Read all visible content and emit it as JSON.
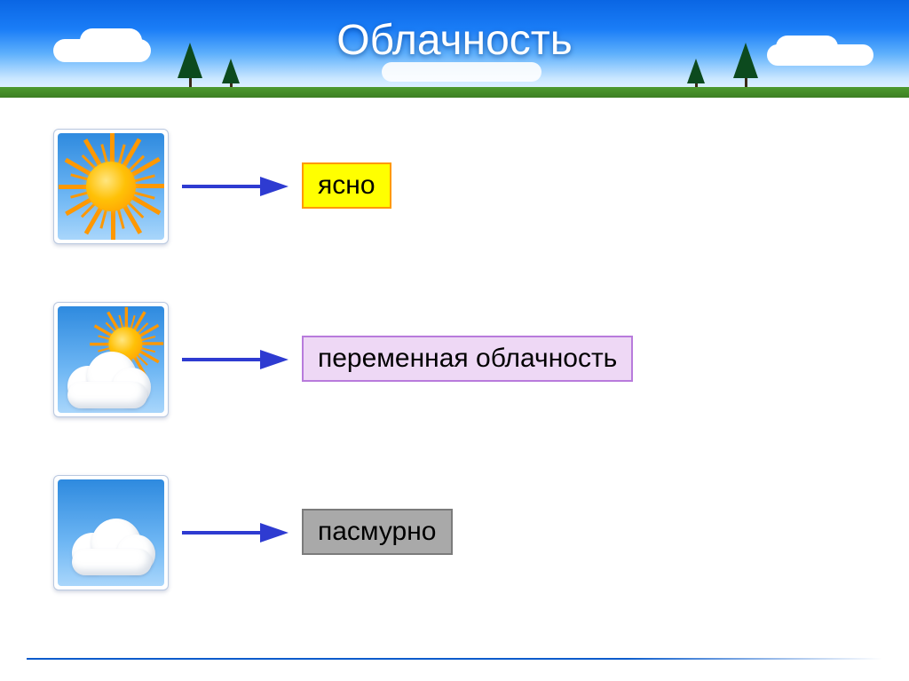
{
  "title": "Облачность",
  "colors": {
    "arrow": "#2e3bd1",
    "label_clear_bg": "#ffff00",
    "label_clear_border": "#ff9900",
    "label_partly_bg": "#eed8f5",
    "label_partly_border": "#b87bdc",
    "label_overcast_bg": "#a9a9a9",
    "label_overcast_border": "#7b7b7b"
  },
  "rows": [
    {
      "icon": "sun",
      "label": "ясно",
      "label_style": "yellow"
    },
    {
      "icon": "sun-cloud",
      "label": "переменная облачность",
      "label_style": "violet"
    },
    {
      "icon": "cloud",
      "label": "пасмурно",
      "label_style": "gray"
    }
  ]
}
